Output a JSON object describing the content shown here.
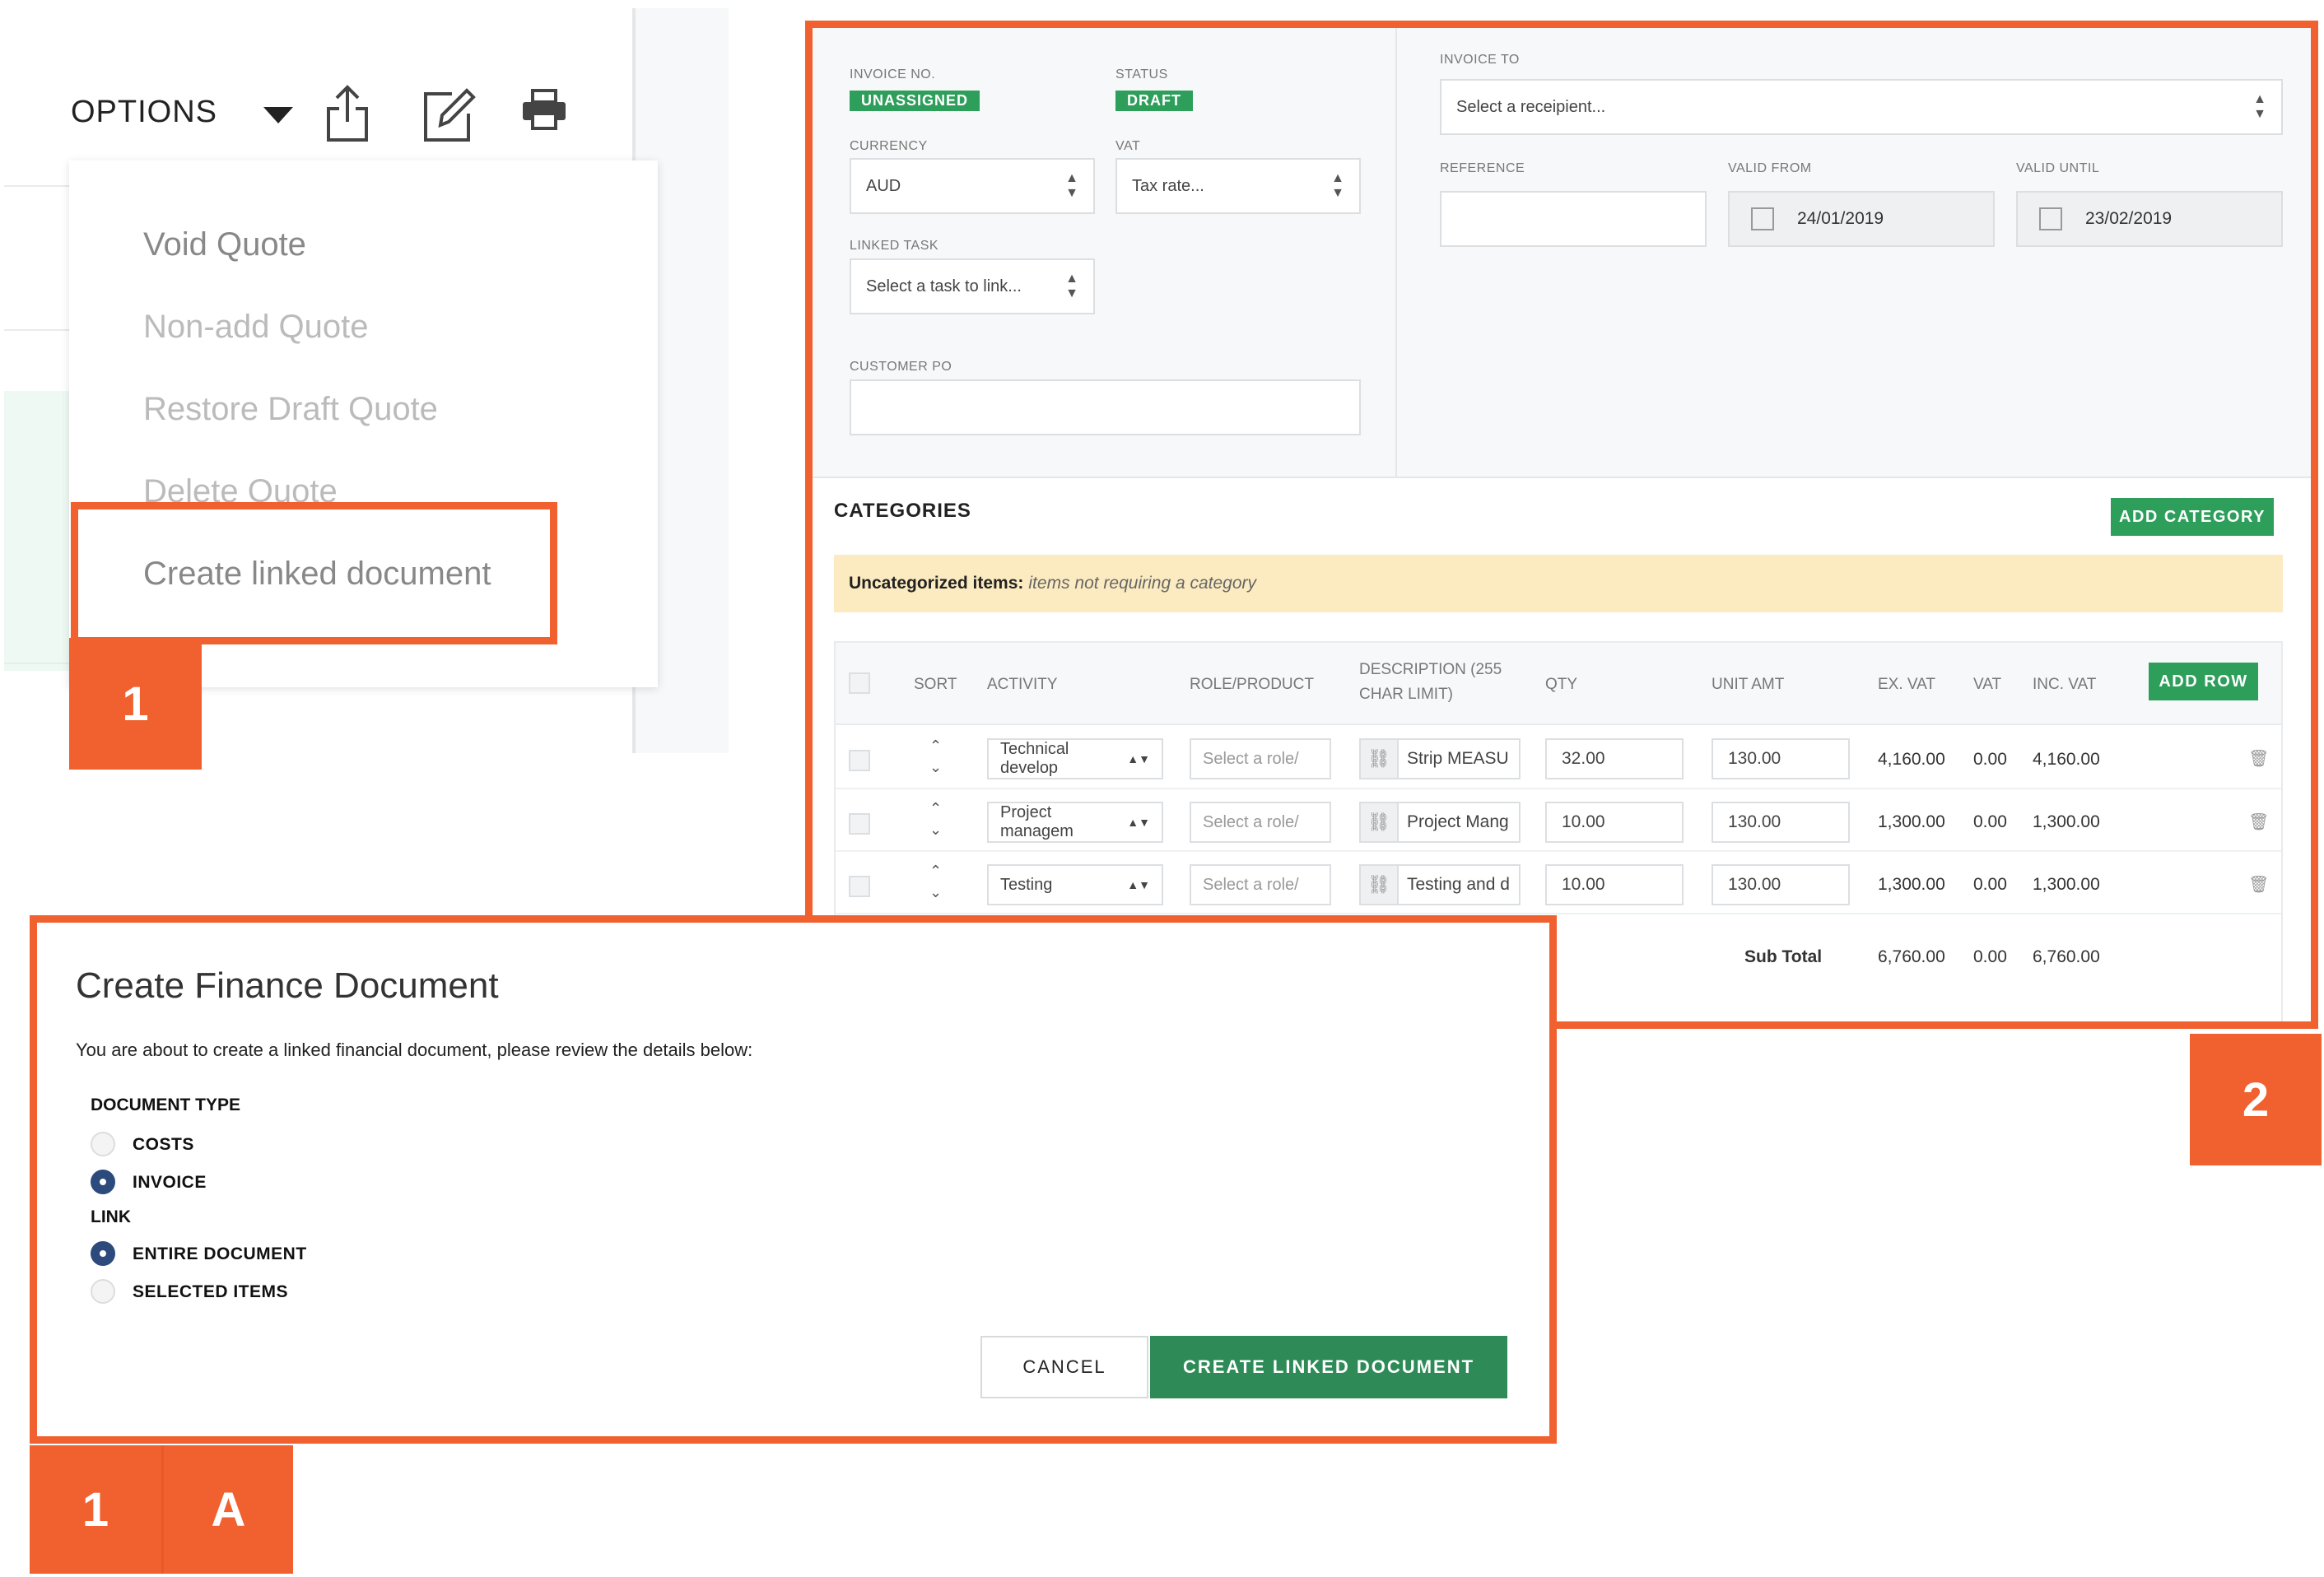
{
  "options_panel": {
    "options_label": "OPTIONS",
    "menu_items": [
      "Void Quote",
      "Non-add Quote",
      "Restore Draft Quote",
      "Delete Quote",
      "Create linked document"
    ],
    "badge": "1"
  },
  "invoice_panel": {
    "badge": "2",
    "invoice_no": {
      "label": "INVOICE NO.",
      "value": "UNASSIGNED"
    },
    "status": {
      "label": "STATUS",
      "value": "DRAFT"
    },
    "currency": {
      "label": "CURRENCY",
      "value": "AUD"
    },
    "vat": {
      "label": "VAT",
      "value": "Tax rate..."
    },
    "linked_task": {
      "label": "LINKED TASK",
      "value": "Select a task to link..."
    },
    "customer_po": {
      "label": "CUSTOMER PO",
      "value": ""
    },
    "invoice_to": {
      "label": "INVOICE TO",
      "value": "Select a receipient..."
    },
    "reference": {
      "label": "REFERENCE",
      "value": ""
    },
    "valid_from": {
      "label": "VALID FROM",
      "value": "24/01/2019"
    },
    "valid_until": {
      "label": "VALID UNTIL",
      "value": "23/02/2019"
    },
    "categories_title": "CATEGORIES",
    "add_category": "ADD CATEGORY",
    "uncategorized_bold": "Uncategorized items:",
    "uncategorized_note": "items not requiring a category",
    "table": {
      "headers": {
        "sort": "SORT",
        "activity": "ACTIVITY",
        "role": "ROLE/PRODUCT",
        "description": "DESCRIPTION (255",
        "description2": "CHAR LIMIT)",
        "qty": "QTY",
        "unit_amt": "UNIT AMT",
        "ex_vat": "EX. VAT",
        "vat": "VAT",
        "inc_vat": "INC. VAT"
      },
      "add_row": "ADD ROW",
      "rows": [
        {
          "activity": "Technical develop",
          "role": "Select a role/",
          "description": "Strip MEASU",
          "qty": "32.00",
          "unit_amt": "130.00",
          "ex_vat": "4,160.00",
          "vat": "0.00",
          "inc_vat": "4,160.00"
        },
        {
          "activity": "Project managem",
          "role": "Select a role/",
          "description": "Project Mang",
          "qty": "10.00",
          "unit_amt": "130.00",
          "ex_vat": "1,300.00",
          "vat": "0.00",
          "inc_vat": "1,300.00"
        },
        {
          "activity": "Testing",
          "role": "Select a role/",
          "description": "Testing and d",
          "qty": "10.00",
          "unit_amt": "130.00",
          "ex_vat": "1,300.00",
          "vat": "0.00",
          "inc_vat": "1,300.00"
        }
      ],
      "subtotal": {
        "label": "Sub Total",
        "ex_vat": "6,760.00",
        "vat": "0.00",
        "inc_vat": "6,760.00"
      }
    }
  },
  "dialog": {
    "title": "Create Finance Document",
    "intro": "You are about to create a linked financial document, please review the details below:",
    "doc_type_label": "DOCUMENT TYPE",
    "doc_type_options": [
      {
        "label": "COSTS",
        "selected": false
      },
      {
        "label": "INVOICE",
        "selected": true
      }
    ],
    "link_label": "LINK",
    "link_options": [
      {
        "label": "ENTIRE DOCUMENT",
        "selected": true
      },
      {
        "label": "SELECTED ITEMS",
        "selected": false
      }
    ],
    "cancel": "CANCEL",
    "create": "CREATE LINKED DOCUMENT",
    "badge_num": "1",
    "badge_letter": "A"
  },
  "colors": {
    "highlight": "#f0612f",
    "green": "#2e9e5b",
    "radio": "#2c4a7c",
    "note_bg": "#fcebc0"
  }
}
